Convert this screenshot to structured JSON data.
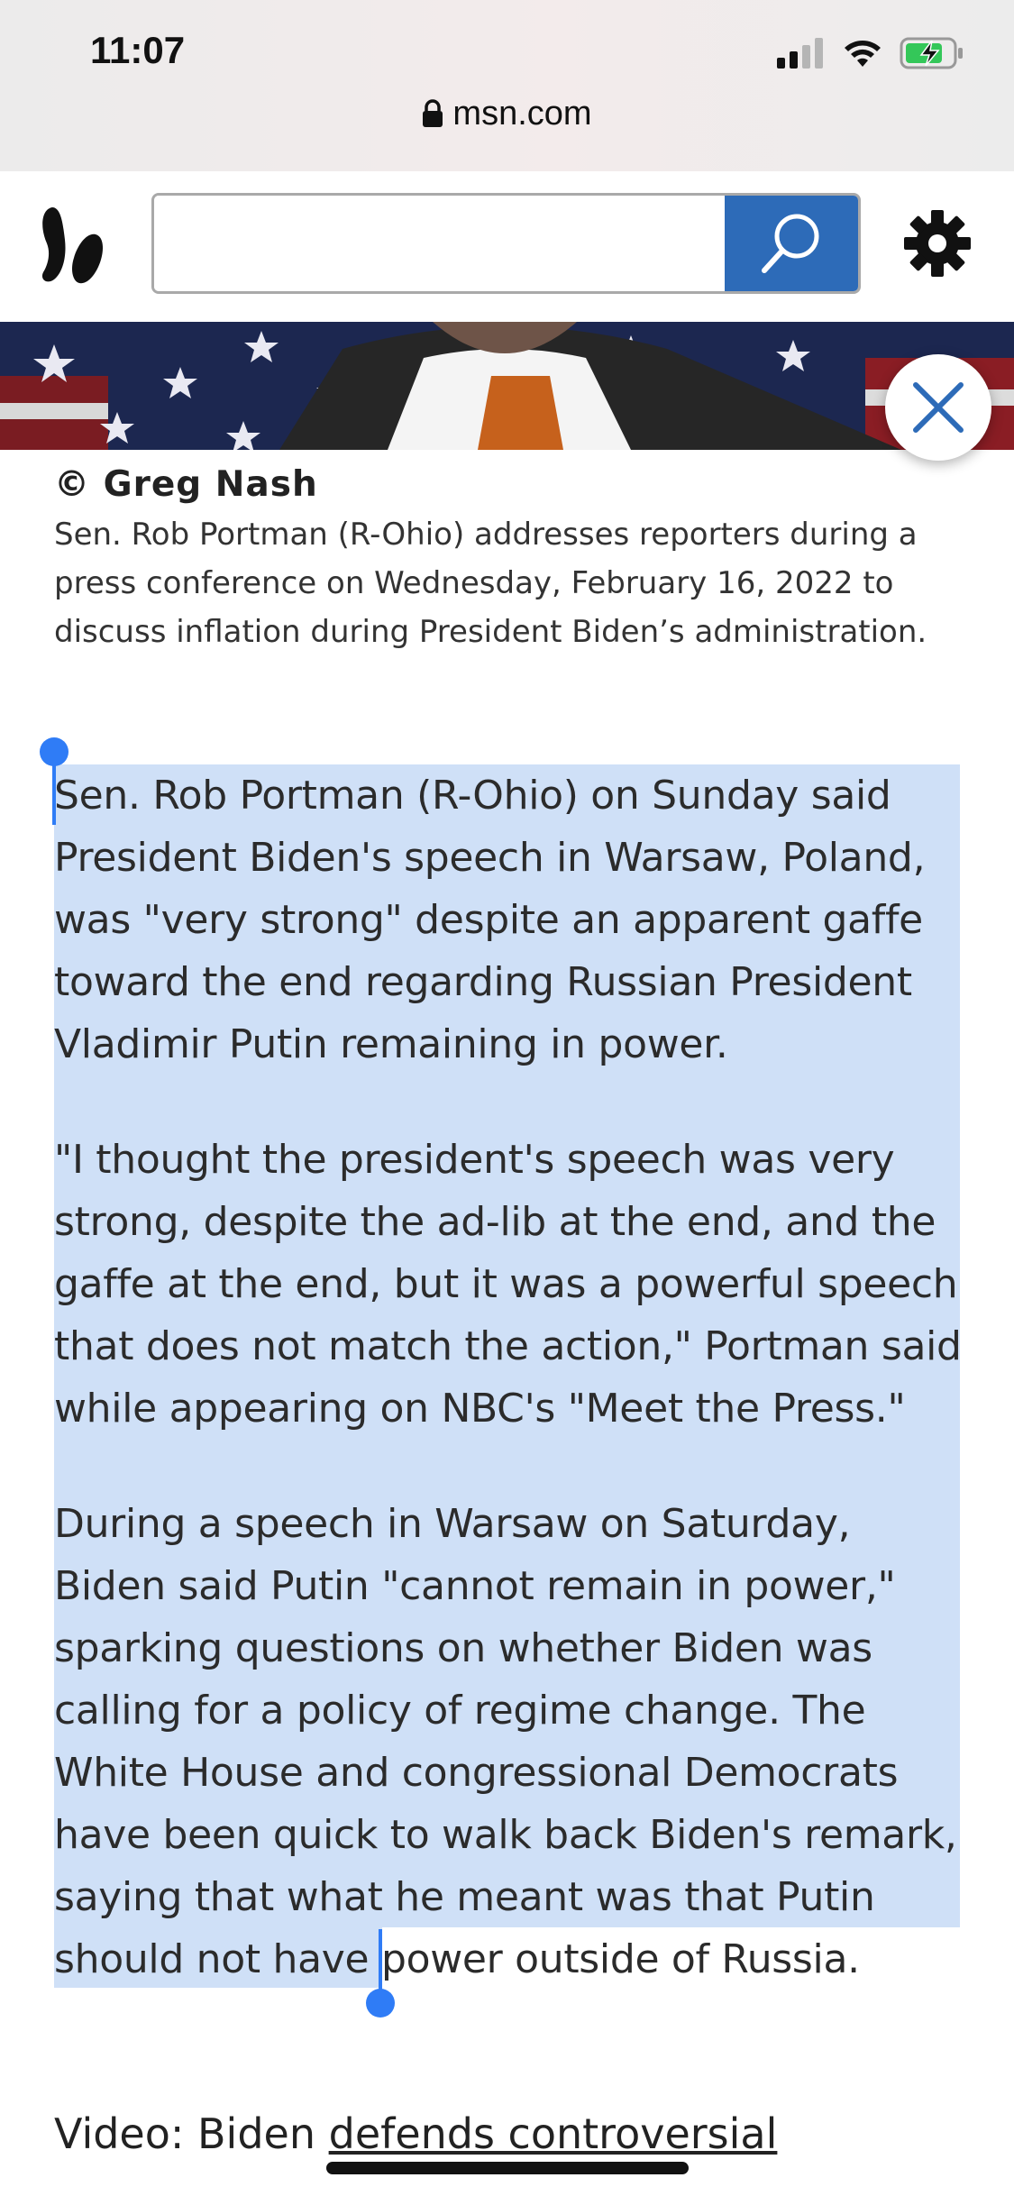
{
  "status": {
    "time": "11:07"
  },
  "browser": {
    "url": "msn.com"
  },
  "header": {
    "search_placeholder": "",
    "icons": [
      "msn-butterfly-logo",
      "search-icon",
      "gear-icon"
    ]
  },
  "photo": {
    "credit": "© Greg Nash",
    "caption": "Sen. Rob Portman (R-Ohio) addresses reporters during a press conference on Wednesday, February 16, 2022 to discuss inflation during President Biden’s administration."
  },
  "article": {
    "paragraphs": [
      "Sen. Rob Portman (R-Ohio) on Sunday said President Biden's speech in Warsaw, Poland, was \"very strong\" despite an apparent gaffe toward the end regarding Russian President Vladimir Putin remaining in power.",
      "\"I thought the president's speech was very strong, despite the ad-lib at the end, and the gaffe at the end, but it was a powerful speech that does not match the action,\" Portman said while appearing on NBC's \"Meet the Press.\"",
      "During a speech in Warsaw on Saturday, Biden said Putin \"cannot remain in power,\" sparking questions on whether Biden was calling for a policy of regime change. The White House and congressional Democrats have been quick to walk back Biden's remark, saying that what he meant was that Putin should not have power outside of Russia."
    ],
    "video_prefix": "Video: Biden ",
    "video_link": "defends controversial"
  },
  "colors": {
    "search_button": "#2d6bb8",
    "selection": "#cfe0f7",
    "selection_handle": "#2f7cf6"
  }
}
